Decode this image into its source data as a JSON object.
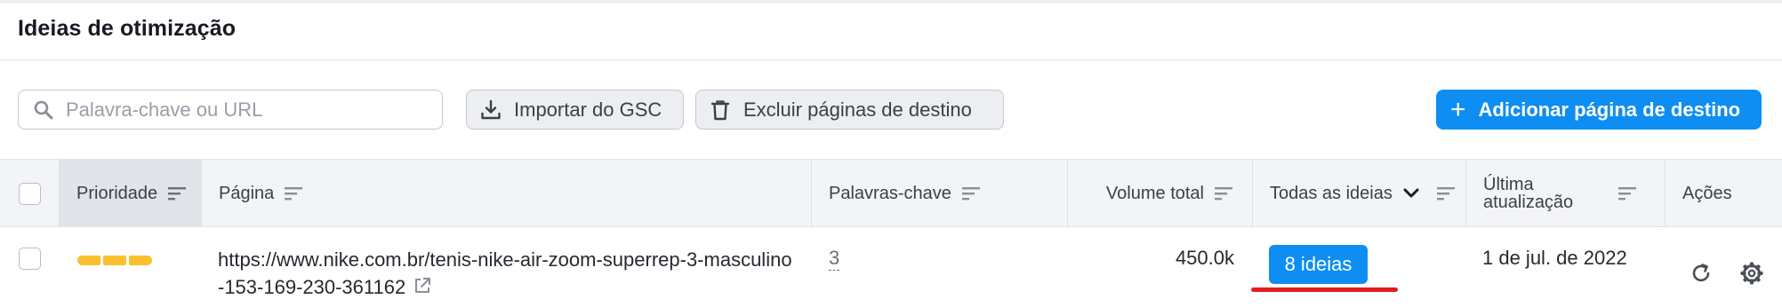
{
  "header": {
    "title": "Ideias de otimização"
  },
  "toolbar": {
    "search_placeholder": "Palavra-chave ou URL",
    "import_label": "Importar do GSC",
    "delete_label": "Excluir páginas de destino",
    "add_label": "Adicionar página de destino",
    "add_plus": "+"
  },
  "table": {
    "columns": {
      "priority": "Prioridade",
      "page": "Página",
      "keywords": "Palavras-chave",
      "volume": "Volume total",
      "ideas": "Todas as ideias",
      "updated_line1": "Última",
      "updated_line2": "atualização",
      "actions": "Ações"
    },
    "rows": [
      {
        "priority_level": "high",
        "priority_segments": 3,
        "page_url": "https://www.nike.com.br/tenis-nike-air-zoom-superrep-3-masculino-153-169-230-361162",
        "keywords": "3",
        "volume": "450.0k",
        "ideas": "8 ideias",
        "updated": "1 de jul. de 2022"
      }
    ]
  },
  "colors": {
    "accent": "#0e8ef2",
    "priority": "#fbc02d",
    "highlight_underline": "#e31b23"
  }
}
